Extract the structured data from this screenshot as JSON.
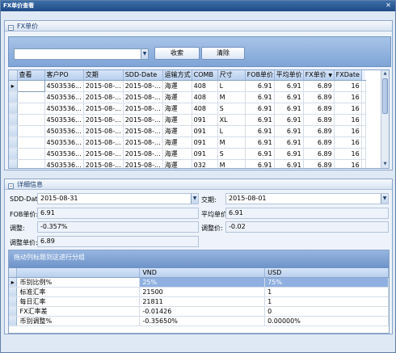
{
  "window": {
    "title": "FX单价查看",
    "close_glyph": "✕"
  },
  "fx_panel": {
    "title": "FX单价",
    "toggle": "−"
  },
  "search": {
    "value": "",
    "search_button": "收索",
    "clear_button": "清除",
    "arrow": "▼"
  },
  "grid": {
    "columns": [
      "查看",
      "客户PO",
      "交期",
      "SDD-Date",
      "运输方式",
      "COMB",
      "尺寸",
      "FOB单价",
      "平均单价",
      "FX单价",
      "FXDate"
    ],
    "sort_indicator": "▼",
    "current_row_marker": "▸",
    "rows": [
      [
        "",
        "4503536...",
        "2015-08-...",
        "2015-08-...",
        "海運",
        "408",
        "L",
        "6.91",
        "6.91",
        "6.89",
        "16"
      ],
      [
        "",
        "4503536...",
        "2015-08-...",
        "2015-08-...",
        "海運",
        "408",
        "M",
        "6.91",
        "6.91",
        "6.89",
        "16"
      ],
      [
        "",
        "4503536...",
        "2015-08-...",
        "2015-08-...",
        "海運",
        "408",
        "S",
        "6.91",
        "6.91",
        "6.89",
        "16"
      ],
      [
        "",
        "4503536...",
        "2015-08-...",
        "2015-08-...",
        "海運",
        "091",
        "XL",
        "6.91",
        "6.91",
        "6.89",
        "16"
      ],
      [
        "",
        "4503536...",
        "2015-08-...",
        "2015-08-...",
        "海運",
        "091",
        "L",
        "6.91",
        "6.91",
        "6.89",
        "16"
      ],
      [
        "",
        "4503536...",
        "2015-08-...",
        "2015-08-...",
        "海運",
        "091",
        "M",
        "6.91",
        "6.91",
        "6.89",
        "16"
      ],
      [
        "",
        "4503536...",
        "2015-08-...",
        "2015-08-...",
        "海運",
        "091",
        "S",
        "6.91",
        "6.91",
        "6.89",
        "16"
      ],
      [
        "",
        "4503536...",
        "2015-08-...",
        "2015-08-...",
        "海運",
        "032",
        "M",
        "6.91",
        "6.91",
        "6.89",
        "16"
      ]
    ]
  },
  "detail_panel": {
    "title": "详细信息",
    "toggle": "−"
  },
  "detail": {
    "sdd_label": "SDD-Date:",
    "sdd_value": "2015-08-31",
    "due_label": "交期:",
    "due_value": "2015-08-01",
    "fob_label": "FOB单价:",
    "fob_value": "6.91",
    "avg_label": "平均单价:",
    "avg_value": "6.91",
    "adj_label": "调整:",
    "adj_value": "-0.357%",
    "adj_price_label": "调整价:",
    "adj_price_value": "-0.02",
    "adjusted_unit_label": "调整单价:",
    "adjusted_unit_value": "6.89",
    "arrow": "▼"
  },
  "sub_grid": {
    "group_hint": "拖动列标题到这进行分组",
    "columns": [
      "",
      "VND",
      "USD"
    ],
    "rows": [
      [
        "币别比例%",
        "25%",
        "75%"
      ],
      [
        "标准汇率",
        "21500",
        "1"
      ],
      [
        "每日汇率",
        "21811",
        "1"
      ],
      [
        "FX汇率差",
        "-0.01426",
        "0"
      ],
      [
        "币别调整%",
        "-0.35650%",
        "0.00000%"
      ]
    ]
  }
}
